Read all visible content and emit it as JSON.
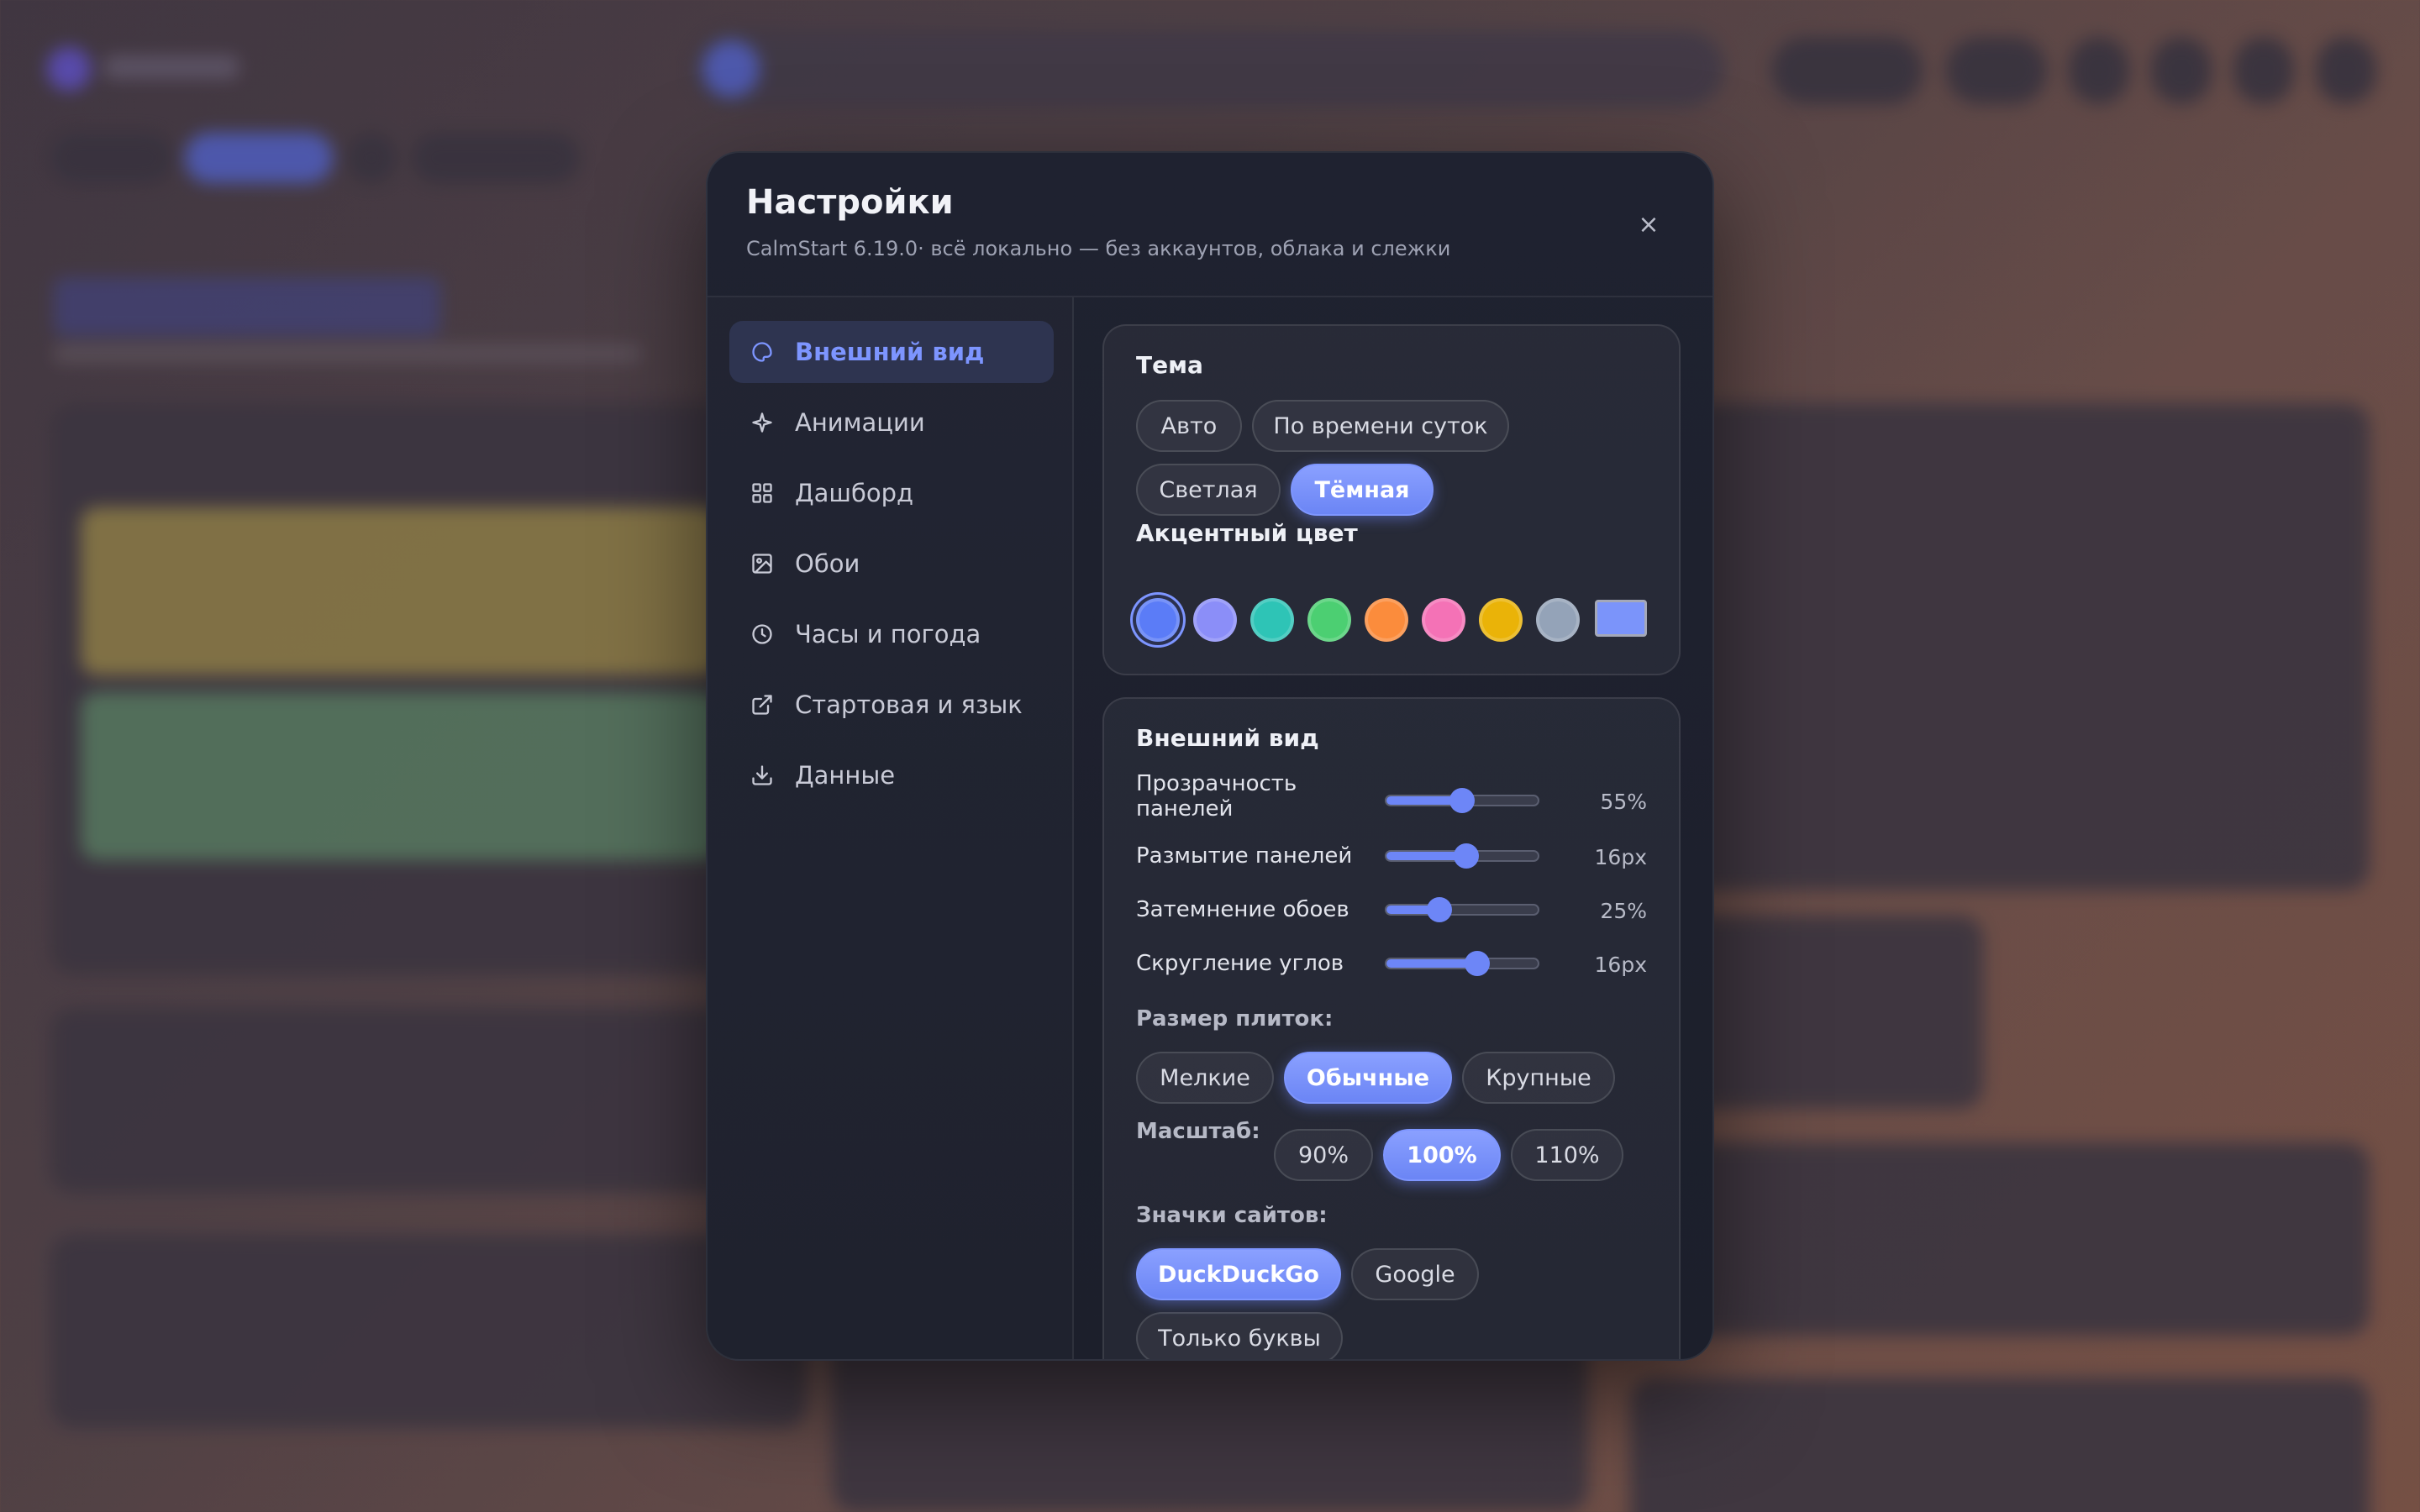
{
  "dialog": {
    "title": "Настройки",
    "subtitle": "CalmStart 6.19.0· всё локально — без аккаунтов, облака и слежки",
    "close_label": "×"
  },
  "sidebar": {
    "items": [
      {
        "label": "Внешний вид",
        "icon": "palette-icon",
        "active": true
      },
      {
        "label": "Анимации",
        "icon": "sparkle-icon",
        "active": false
      },
      {
        "label": "Дашборд",
        "icon": "grid-icon",
        "active": false
      },
      {
        "label": "Обои",
        "icon": "image-icon",
        "active": false
      },
      {
        "label": "Часы и погода",
        "icon": "clock-icon",
        "active": false
      },
      {
        "label": "Стартовая и язык",
        "icon": "external-link-icon",
        "active": false
      },
      {
        "label": "Данные",
        "icon": "download-icon",
        "active": false
      }
    ]
  },
  "theme": {
    "title": "Тема",
    "options": [
      "Авто",
      "По времени суток",
      "Светлая",
      "Тёмная"
    ],
    "selected": "Тёмная"
  },
  "accent": {
    "title": "Акцентный цвет",
    "swatches": [
      "#5b7cf7",
      "#8b8ef8",
      "#2ec4b6",
      "#4ccf72",
      "#fb8c3c",
      "#f472b6",
      "#eab308",
      "#94a3b8"
    ],
    "selected_index": 0,
    "custom_color": "#7b94fa"
  },
  "appearance": {
    "title": "Внешний вид",
    "sliders": [
      {
        "label": "Прозрачность панелей",
        "value_text": "55%",
        "fraction": 0.5
      },
      {
        "label": "Размытие панелей",
        "value_text": "16px",
        "fraction": 0.53
      },
      {
        "label": "Затемнение обоев",
        "value_text": "25%",
        "fraction": 0.35
      },
      {
        "label": "Скругление углов",
        "value_text": "16px",
        "fraction": 0.6
      }
    ],
    "tile_size": {
      "label": "Размер плиток:",
      "options": [
        "Мелкие",
        "Обычные",
        "Крупные"
      ],
      "selected": "Обычные"
    },
    "scale": {
      "label": "Масштаб:",
      "options": [
        "90%",
        "100%",
        "110%"
      ],
      "selected": "100%"
    },
    "site_icons": {
      "label": "Значки сайтов:",
      "options": [
        "DuckDuckGo",
        "Google",
        "Только буквы"
      ],
      "selected": "DuckDuckGo"
    }
  }
}
